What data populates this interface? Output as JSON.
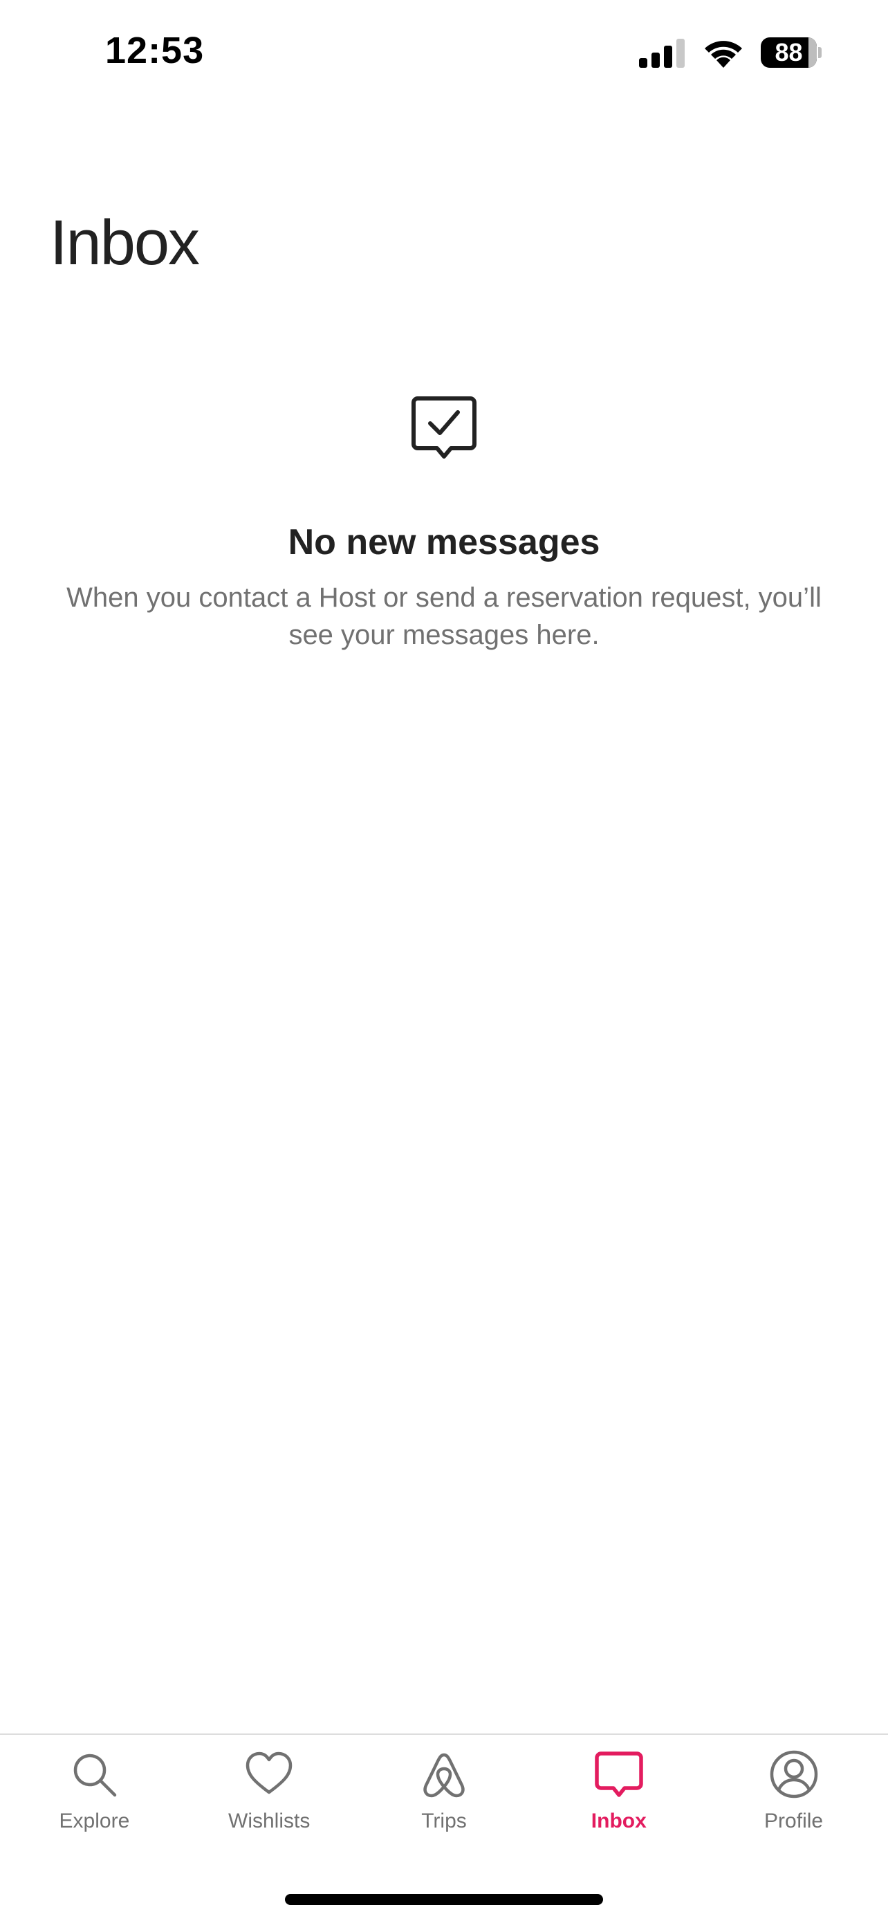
{
  "status_bar": {
    "time": "12:53",
    "battery": "88"
  },
  "page": {
    "title": "Inbox"
  },
  "empty_state": {
    "icon": "chat-check-icon",
    "title": "No new messages",
    "subtitle": "When you contact a Host or send a reservation request, you’ll see your messages here."
  },
  "nav": {
    "items": [
      {
        "label": "Explore",
        "icon": "search-icon",
        "active": false
      },
      {
        "label": "Wishlists",
        "icon": "heart-icon",
        "active": false
      },
      {
        "label": "Trips",
        "icon": "airbnb-logo-icon",
        "active": false
      },
      {
        "label": "Inbox",
        "icon": "chat-bubble-icon",
        "active": true
      },
      {
        "label": "Profile",
        "icon": "profile-icon",
        "active": false
      }
    ]
  },
  "colors": {
    "accent": "#E31C5F",
    "inactive": "#717171",
    "text": "#222222"
  }
}
